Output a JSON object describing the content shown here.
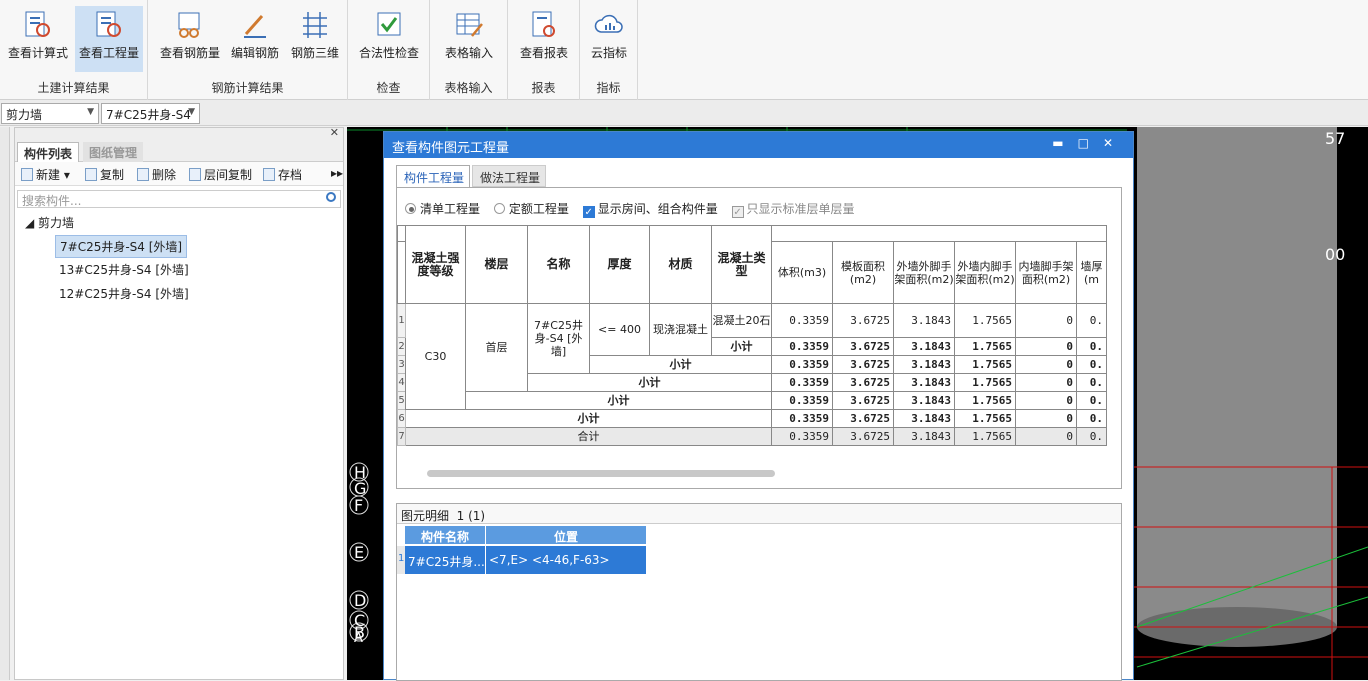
{
  "ribbon": {
    "groups": [
      {
        "label": "土建计算结果",
        "buttons": [
          "查看计算式",
          "查看工程量"
        ]
      },
      {
        "label": "钢筋计算结果",
        "buttons": [
          "查看钢筋量",
          "编辑钢筋",
          "钢筋三维"
        ]
      },
      {
        "label": "检查",
        "buttons": [
          "合法性检查"
        ]
      },
      {
        "label": "表格输入",
        "buttons": [
          "表格输入"
        ]
      },
      {
        "label": "报表",
        "buttons": [
          "查看报表"
        ]
      },
      {
        "label": "指标",
        "buttons": [
          "云指标"
        ]
      }
    ],
    "active_button": "查看工程量",
    "accent": "#cde0f4"
  },
  "selectors": {
    "category": "剪力墙",
    "component": "7#C25井身-S4"
  },
  "left_panel": {
    "tabs": [
      "构件列表",
      "图纸管理"
    ],
    "tools": [
      "新建",
      "复制",
      "删除",
      "层间复制",
      "存档"
    ],
    "search_placeholder": "搜索构件...",
    "tree_root": "剪力墙",
    "items": [
      "7#C25井身-S4 [外墙]",
      "13#C25井身-S4 [外墙]",
      "12#C25井身-S4 [外墙]"
    ],
    "selected_index": 0
  },
  "dialog": {
    "title": "查看构件图元工程量",
    "tabs": [
      "构件工程量",
      "做法工程量"
    ],
    "options": {
      "radio_list": "清单工程量",
      "radio_quota": "定额工程量",
      "check_room": "显示房间、组合构件量",
      "check_std": "只显示标准层单层量"
    },
    "table": {
      "headers": [
        "混凝土强度等级",
        "楼层",
        "名称",
        "厚度",
        "材质",
        "混凝土类型",
        "体积(m3)",
        "模板面积(m2)",
        "外墙外脚手架面积(m2)",
        "外墙内脚手架面积(m2)",
        "内墙脚手架面积(m2)",
        "墙厚(m"
      ],
      "group": {
        "grade": "C30",
        "floor": "首层",
        "name": "7#C25井身-S4 [外墙]",
        "thickness": "<= 400",
        "material": "现浇混凝土",
        "concrete": "混凝土20石"
      },
      "subtotal_label": "小计",
      "total_label": "合计",
      "row_values": [
        "0.3359",
        "3.6725",
        "3.1843",
        "1.7565",
        "0",
        "0."
      ]
    },
    "detail": {
      "title": "图元明细",
      "count": "1 (1)",
      "headers": [
        "构件名称",
        "位置"
      ],
      "row": {
        "name": "7#C25井身...",
        "position": "<7,E> <4-46,F-63>"
      }
    }
  },
  "cad_labels": [
    "H",
    "G",
    "F",
    "E",
    "D",
    "C",
    "B",
    "A",
    "57",
    "00"
  ]
}
